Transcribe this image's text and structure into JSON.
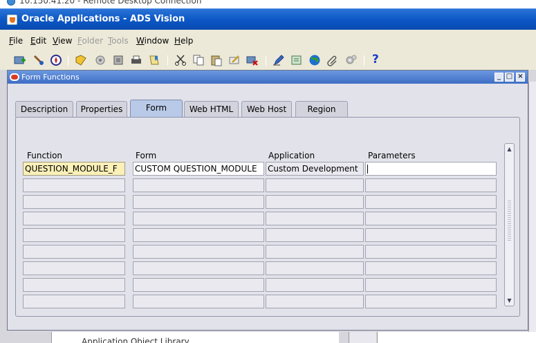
{
  "rdp": {
    "title": "10.150.41.20 - Remote Desktop Connection"
  },
  "app": {
    "title": "Oracle Applications - ADS Vision"
  },
  "menu": [
    {
      "label": "File",
      "enabled": true
    },
    {
      "label": "Edit",
      "enabled": true
    },
    {
      "label": "View",
      "enabled": true
    },
    {
      "label": "Folder",
      "enabled": false
    },
    {
      "label": "Tools",
      "enabled": false
    },
    {
      "label": "Window",
      "enabled": true
    },
    {
      "label": "Help",
      "enabled": true
    }
  ],
  "toolbar": {
    "icons": [
      "new-record-icon",
      "find-icon",
      "navigator-icon",
      "save-icon",
      "switch-responsibility-icon",
      "print-icon",
      "close-form-icon",
      "bookmark-icon",
      "cut-icon",
      "copy-icon",
      "paste-icon",
      "clear-record-icon",
      "delete-record-icon",
      "edit-field-icon",
      "zoom-icon",
      "translations-icon",
      "attachments-icon",
      "folder-tools-icon"
    ],
    "help_label": "?"
  },
  "form": {
    "title": "Form Functions",
    "tabs": [
      {
        "label": "Description",
        "active": false
      },
      {
        "label": "Properties",
        "active": false
      },
      {
        "label": "Form",
        "active": true
      },
      {
        "label": "Web HTML",
        "active": false
      },
      {
        "label": "Web Host",
        "active": false
      },
      {
        "label": "Region",
        "active": false
      }
    ],
    "columns": [
      "Function",
      "Form",
      "Application",
      "Parameters"
    ],
    "rows": [
      {
        "function": "QUESTION_MODULE_F",
        "form": "CUSTOM QUESTION_MODULE",
        "application": "Custom Development",
        "parameters": ""
      },
      {
        "function": "",
        "form": "",
        "application": "",
        "parameters": ""
      },
      {
        "function": "",
        "form": "",
        "application": "",
        "parameters": ""
      },
      {
        "function": "",
        "form": "",
        "application": "",
        "parameters": ""
      },
      {
        "function": "",
        "form": "",
        "application": "",
        "parameters": ""
      },
      {
        "function": "",
        "form": "",
        "application": "",
        "parameters": ""
      },
      {
        "function": "",
        "form": "",
        "application": "",
        "parameters": ""
      },
      {
        "function": "",
        "form": "",
        "application": "",
        "parameters": ""
      },
      {
        "function": "",
        "form": "",
        "application": "",
        "parameters": ""
      }
    ]
  },
  "background": {
    "partial_text": "Application Object Library"
  }
}
